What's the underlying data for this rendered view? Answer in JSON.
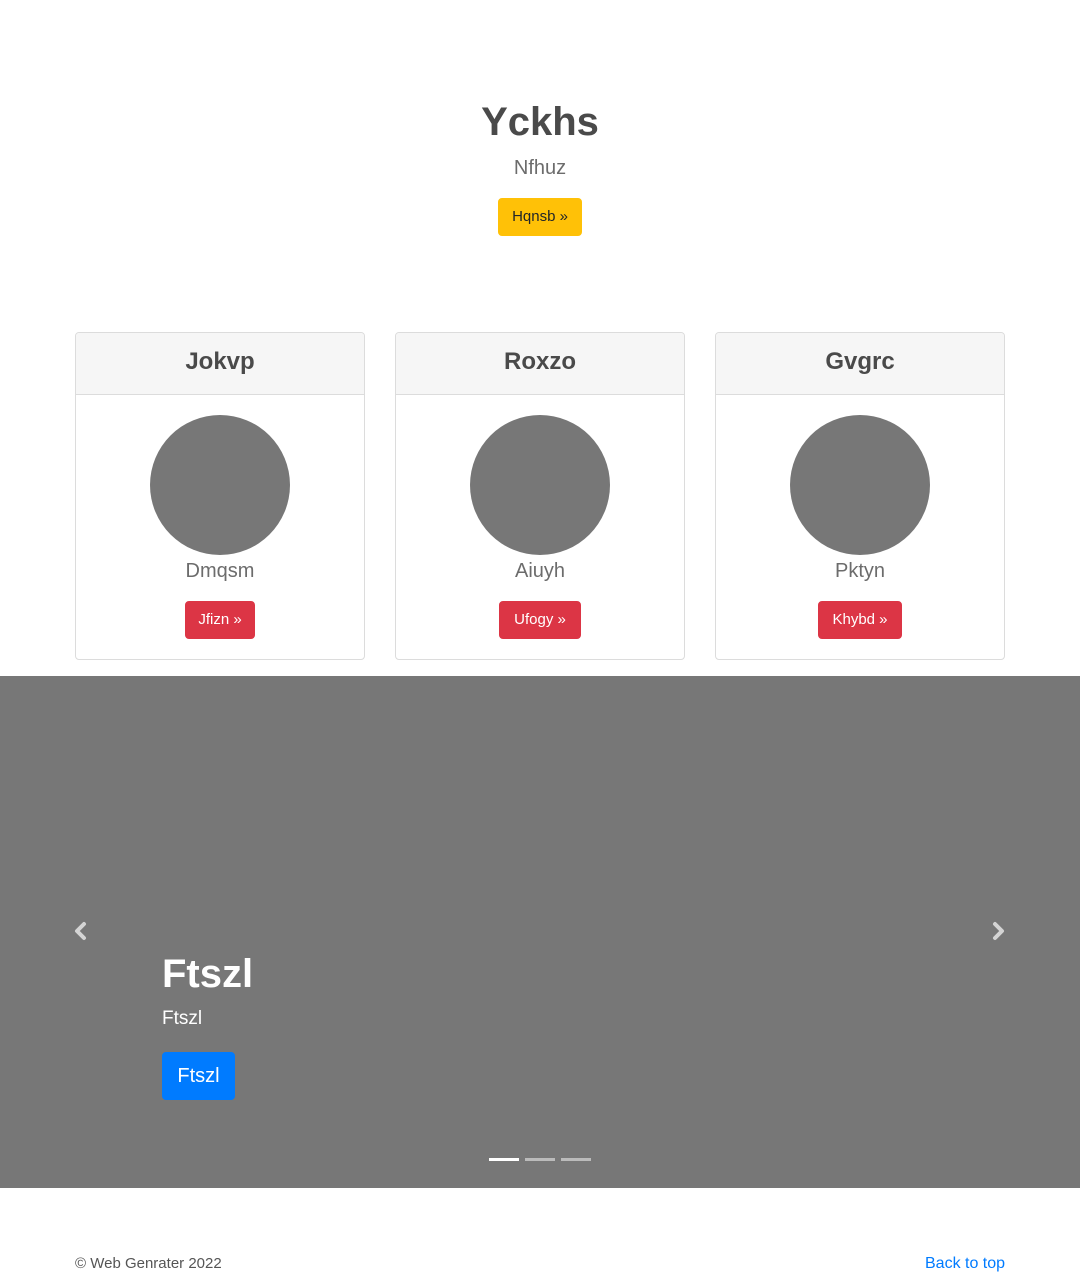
{
  "hero": {
    "title": "Yckhs",
    "subtitle": "Nfhuz",
    "button_label": "Hqnsb »",
    "button_color": "#ffc107"
  },
  "cards": [
    {
      "header": "Jokvp",
      "text": "Dmqsm",
      "button_label": "Jfizn »"
    },
    {
      "header": "Roxzo",
      "text": "Aiuyh",
      "button_label": "Ufogy »"
    },
    {
      "header": "Gvgrc",
      "text": "Pktyn",
      "button_label": "Khybd »"
    }
  ],
  "card_button_color": "#dc3545",
  "carousel": {
    "background": "#777777",
    "prev_icon": "chevron-left-icon",
    "next_icon": "chevron-right-icon",
    "slide": {
      "title": "Ftszl",
      "text": "Ftszl",
      "button_label": "Ftszl",
      "button_color": "#007bff"
    },
    "indicator_count": 3,
    "active_indicator": 1
  },
  "footer": {
    "copyright": "© Web Genrater 2022",
    "back_to_top": "Back to top"
  }
}
